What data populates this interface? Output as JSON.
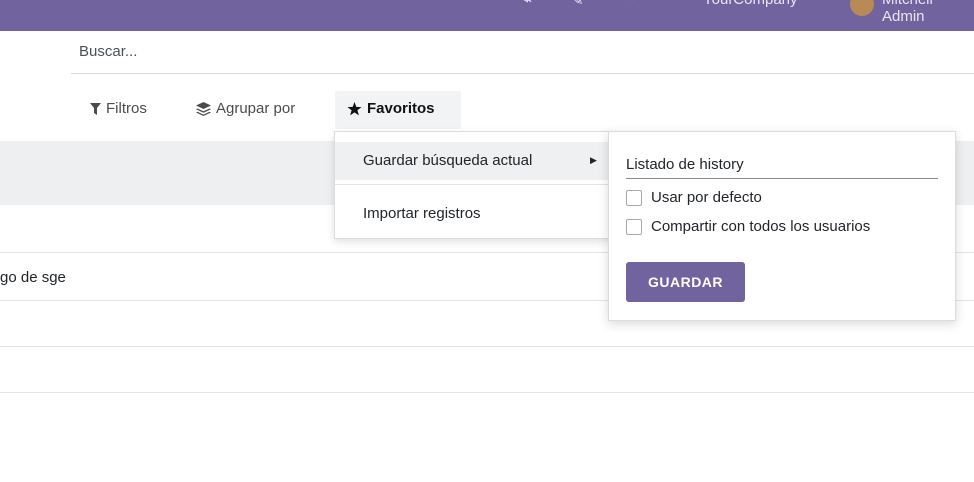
{
  "topbar": {
    "company": "YourCompany",
    "user": "Mitchell Admin",
    "color": "#71639e"
  },
  "search": {
    "placeholder": "Buscar..."
  },
  "filters": {
    "filters_label": "Filtros",
    "groupby_label": "Agrupar por",
    "favorites_label": "Favoritos"
  },
  "list": {
    "row_text": "go de sge"
  },
  "favorites_menu": {
    "save_current_label": "Guardar búsqueda actual",
    "import_label": "Importar registros"
  },
  "save_panel": {
    "name_value": "Listado de history",
    "default_label": "Usar por defecto",
    "share_label": "Compartir con todos los usuarios",
    "save_button": "GUARDAR"
  },
  "icons": {
    "filter": "filter-icon",
    "group": "layers-icon",
    "favorite": "star-icon",
    "caret": "caret-right-icon"
  }
}
